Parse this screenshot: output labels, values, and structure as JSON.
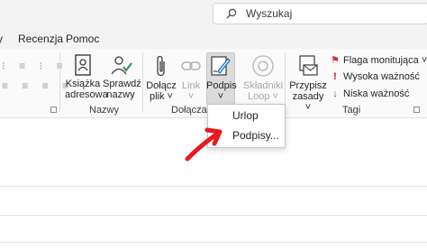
{
  "search": {
    "placeholder": "Wyszukaj",
    "icon": "search-icon"
  },
  "tabs": [
    {
      "label": "Recenzja"
    },
    {
      "label": "Pomoc"
    }
  ],
  "ribbon": {
    "address_book": {
      "line1": "Książka",
      "line2": "adresowa"
    },
    "check_names": {
      "line1": "Sprawdź",
      "line2": "nazwy"
    },
    "attach_file": {
      "line1": "Dołącz",
      "line2": "plik ˅"
    },
    "link": {
      "line1": "Link",
      "line2": "˅"
    },
    "signature": {
      "line1": "Podpis",
      "line2": "˅"
    },
    "loop": {
      "line1": "Składniki",
      "line2": "Loop ˅"
    },
    "assign_policy": {
      "line1": "Przypisz",
      "line2": "zasady ˅"
    },
    "groups": {
      "names": "Nazwy",
      "include": "Dołączanie",
      "tags": "Tagi"
    },
    "tags": {
      "follow_up": "Flaga monitująca ˅",
      "high_importance": "Wysoka ważność",
      "low_importance": "Niska ważność"
    }
  },
  "signature_menu": {
    "items": [
      {
        "label": "Urlop"
      },
      {
        "label": "Podpisy..."
      }
    ]
  },
  "colors": {
    "flag": "#d13438",
    "high": "#c50f1f",
    "low": "#0f6cbd",
    "arrow": "#e8191f"
  }
}
